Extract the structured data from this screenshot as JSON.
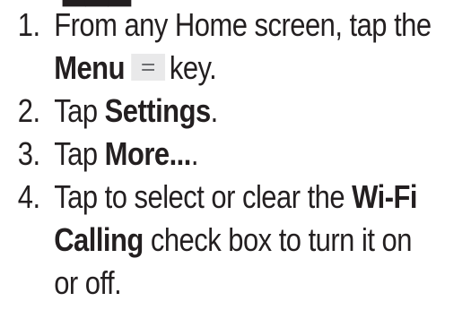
{
  "steps": [
    {
      "number": "1.",
      "lines": [
        {
          "parts": [
            {
              "text": "From any Home screen, tap the",
              "bold": false
            }
          ]
        },
        {
          "parts": [
            {
              "text": "Menu",
              "bold": true
            },
            {
              "icon": "menu-icon"
            },
            {
              "text": "key.",
              "bold": false
            }
          ]
        }
      ]
    },
    {
      "number": "2.",
      "lines": [
        {
          "parts": [
            {
              "text": "Tap ",
              "bold": false
            },
            {
              "text": "Settings",
              "bold": true
            },
            {
              "text": ".",
              "bold": false
            }
          ]
        }
      ]
    },
    {
      "number": "3.",
      "lines": [
        {
          "parts": [
            {
              "text": "Tap ",
              "bold": false
            },
            {
              "text": "More...",
              "bold": true
            },
            {
              "text": ".",
              "bold": false
            }
          ]
        }
      ]
    },
    {
      "number": "4.",
      "lines": [
        {
          "parts": [
            {
              "text": "Tap to select or clear the ",
              "bold": false
            },
            {
              "text": "Wi-Fi",
              "bold": true
            }
          ]
        },
        {
          "parts": [
            {
              "text": "Calling",
              "bold": true
            },
            {
              "text": " check box to turn it on",
              "bold": false
            }
          ]
        },
        {
          "parts": [
            {
              "text": "or off.",
              "bold": false
            }
          ]
        }
      ]
    }
  ],
  "colors": {
    "text": "#231f20",
    "icon_bg": "#e9e9ea",
    "icon_lines": "#6d6e71"
  }
}
